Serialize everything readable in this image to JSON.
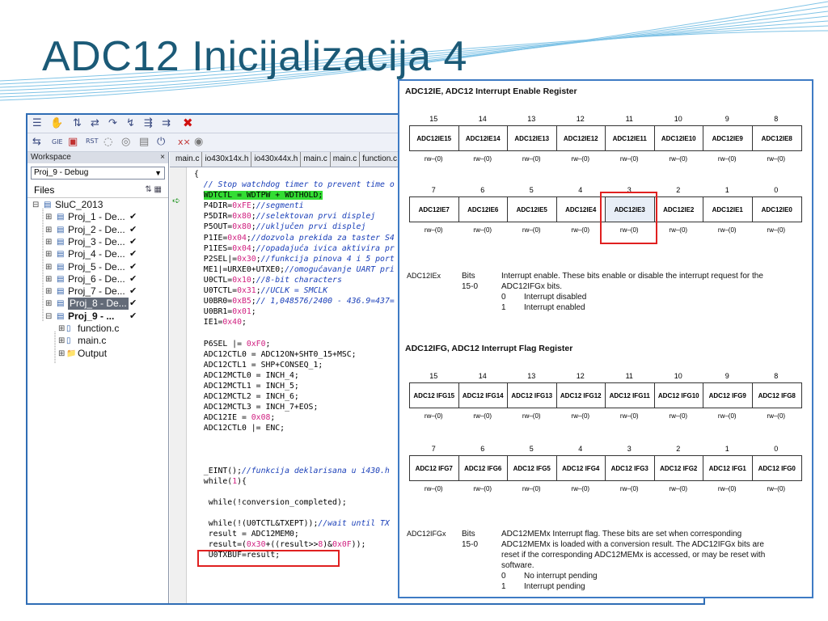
{
  "slide": {
    "title": "ADC12 Inicijalizacija 4"
  },
  "ide": {
    "workspace": {
      "header": "Workspace",
      "close": "×",
      "config": "Proj_9 - Debug",
      "files_label": "Files",
      "tree": [
        {
          "text": "SluC_2013",
          "check": "",
          "level": 0
        },
        {
          "text": "Proj_1 - De...",
          "check": "✔",
          "level": 1
        },
        {
          "text": "Proj_2 - De...",
          "check": "✔",
          "level": 1
        },
        {
          "text": "Proj_3 - De...",
          "check": "✔",
          "level": 1
        },
        {
          "text": "Proj_4 - De...",
          "check": "✔",
          "level": 1
        },
        {
          "text": "Proj_5 - De...",
          "check": "✔",
          "level": 1
        },
        {
          "text": "Proj_6 - De...",
          "check": "✔",
          "level": 1
        },
        {
          "text": "Proj_7 - De...",
          "check": "✔",
          "level": 1
        },
        {
          "text": "Proj_8 - De...",
          "check": "✔",
          "level": 1
        },
        {
          "text": "Proj_9 - ...",
          "check": "✔",
          "level": 1
        },
        {
          "text": "function.c",
          "check": "",
          "level": 2
        },
        {
          "text": "main.c",
          "check": "",
          "level": 2
        },
        {
          "text": "Output",
          "check": "",
          "level": 2
        }
      ]
    },
    "tabs": [
      "main.c",
      "io430x14x.h",
      "io430x44x.h",
      "main.c",
      "main.c",
      "function.c"
    ],
    "code": [
      "{",
      "  // Stop watchdog timer to prevent time o",
      "  WDTCTL = WDTPW + WDTHOLD;",
      "  P4DIR=0xFE;//segmenti",
      "  P5DIR=0x80;//selektovan prvi displej",
      "  P5OUT=0x80;//uključen prvi displej",
      "  P1IE=0x04;//dozvola prekida za taster S4",
      "  P1IES=0x04;//opadajuća ivica aktivira pr",
      "  P2SEL|=0x30;//funkcija pinova 4 i 5 port",
      "  ME1|=URXE0+UTXE0;//omogućavanje UART pri",
      "  U0CTL=0x10;//8-bit characters",
      "  U0TCTL=0x31;//UCLK = SMCLK",
      "  U0BR0=0xB5;// 1,048576/2400 - 436.9=437=",
      "  U0BR1=0x01;",
      "  IE1=0x40;",
      "",
      "  P6SEL |= 0xF0;",
      "  ADC12CTL0 = ADC12ON+SHT0_15+MSC;",
      "  ADC12CTL1 = SHP+CONSEQ_1;",
      "  ADC12MCTL0 = INCH_4;",
      "  ADC12MCTL1 = INCH_5;",
      "  ADC12MCTL2 = INCH_6;",
      "  ADC12MCTL3 = INCH_7+EOS;",
      "  ADC12IE = 0x08;",
      "  ADC12CTL0 |= ENC;",
      "",
      "",
      "",
      "  _EINT();//funkcija deklarisana u i430.h",
      "  while(1){",
      "",
      "   while(!conversion_completed);",
      "",
      "   while(!(U0TCTL&TXEPT));//wait until TX",
      "   result = ADC12MEM0;",
      "   result=(0x30+((result>>8)&0x0F));",
      "   U0TXBUF=result;"
    ]
  },
  "datasheet": {
    "ie_title": "ADC12IE, ADC12 Interrupt Enable Register",
    "ie_high_bits": [
      "15",
      "14",
      "13",
      "12",
      "11",
      "10",
      "9",
      "8"
    ],
    "ie_high_names": [
      "ADC12IE15",
      "ADC12IE14",
      "ADC12IE13",
      "ADC12IE12",
      "ADC12IE11",
      "ADC12IE10",
      "ADC12IE9",
      "ADC12IE8"
    ],
    "ie_low_bits": [
      "7",
      "6",
      "5",
      "4",
      "3",
      "2",
      "1",
      "0"
    ],
    "ie_low_names": [
      "ADC12IE7",
      "ADC12IE6",
      "ADC12IE5",
      "ADC12IE4",
      "ADC12IE3",
      "ADC12IE2",
      "ADC12IE1",
      "ADC12IE0"
    ],
    "access": "rw–(0)",
    "ie_desc": {
      "name": "ADC12IEx",
      "bits_label": "Bits",
      "bits_range": "15-0",
      "text1": "Interrupt enable. These bits enable or disable the interrupt request for the",
      "text2": "ADC12IFGx bits.",
      "v0": "0",
      "v0_text": "Interrupt disabled",
      "v1": "1",
      "v1_text": "Interrupt enabled"
    },
    "ifg_title": "ADC12IFG, ADC12 Interrupt Flag Register",
    "ifg_high_names": [
      "ADC12 IFG15",
      "ADC12 IFG14",
      "ADC12 IFG13",
      "ADC12 IFG12",
      "ADC12 IFG11",
      "ADC12 IFG10",
      "ADC12 IFG9",
      "ADC12 IFG8"
    ],
    "ifg_low_names": [
      "ADC12 IFG7",
      "ADC12 IFG6",
      "ADC12 IFG5",
      "ADC12 IFG4",
      "ADC12 IFG3",
      "ADC12 IFG2",
      "ADC12 IFG1",
      "ADC12 IFG0"
    ],
    "ifg_desc": {
      "name": "ADC12IFGx",
      "bits_label": "Bits",
      "bits_range": "15-0",
      "line1": "ADC12MEMx Interrupt flag. These bits are set when corresponding",
      "line2": "ADC12MEMx is loaded with a conversion result. The ADC12IFGx bits are",
      "line3": "reset if the corresponding ADC12MEMx is accessed, or may be reset with",
      "line4": "software.",
      "v0": "0",
      "v0_text": "No interrupt pending",
      "v1": "1",
      "v1_text": "Interrupt pending"
    }
  }
}
